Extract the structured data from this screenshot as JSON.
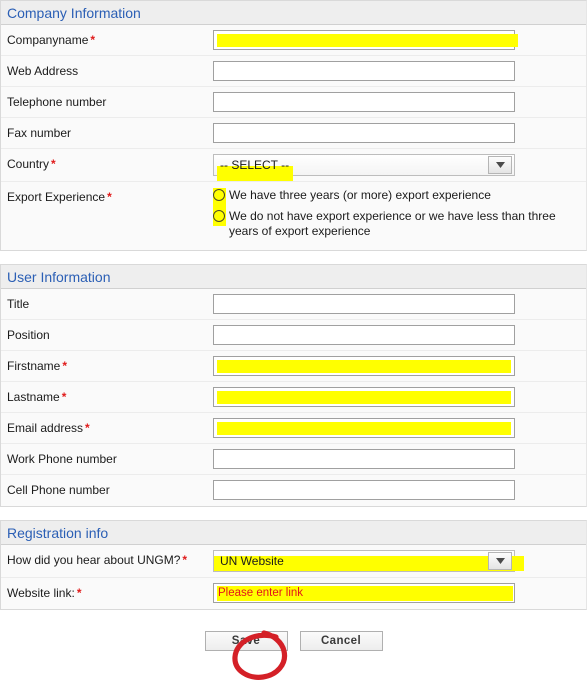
{
  "form": {
    "sections": [
      {
        "id": "company-information",
        "title": "Company Information",
        "rows": [
          {
            "label": "Companyname",
            "required": true,
            "control": "text",
            "value": "",
            "highlight": "yellow-overhang"
          },
          {
            "label": "Web Address",
            "required": false,
            "control": "text",
            "value": "",
            "highlight": "none"
          },
          {
            "label": "Telephone number",
            "required": false,
            "control": "text",
            "value": "",
            "highlight": "none"
          },
          {
            "label": "Fax number",
            "required": false,
            "control": "text",
            "value": "",
            "highlight": "none"
          },
          {
            "label": "Country",
            "required": true,
            "control": "select",
            "value": "-- SELECT --",
            "highlight": "yellow-text"
          },
          {
            "label": "Export Experience",
            "required": true,
            "control": "radio-group",
            "highlight": "yellow-strip",
            "options": [
              "We have three years (or more) export experience",
              "We do not have export experience or we have less than three years of export experience"
            ],
            "selected": -1
          }
        ]
      },
      {
        "id": "user-information",
        "title": "User Information",
        "rows": [
          {
            "label": "Title",
            "required": false,
            "control": "text",
            "value": "",
            "highlight": "none"
          },
          {
            "label": "Position",
            "required": false,
            "control": "text",
            "value": "",
            "highlight": "none"
          },
          {
            "label": "Firstname",
            "required": true,
            "control": "text",
            "value": "",
            "highlight": "yellow"
          },
          {
            "label": "Lastname",
            "required": true,
            "control": "text",
            "value": "",
            "highlight": "yellow"
          },
          {
            "label": "Email address",
            "required": true,
            "control": "text",
            "value": "",
            "highlight": "yellow"
          },
          {
            "label": "Work Phone number",
            "required": false,
            "control": "text",
            "value": "",
            "highlight": "none"
          },
          {
            "label": "Cell Phone number",
            "required": false,
            "control": "text",
            "value": "",
            "highlight": "none"
          }
        ]
      },
      {
        "id": "registration-info",
        "title": "Registration info",
        "rows": [
          {
            "label": "How did you hear about UNGM?",
            "required": true,
            "control": "select",
            "value": "UN Website",
            "highlight": "yellow-band"
          },
          {
            "label": "Website link:",
            "required": true,
            "control": "text",
            "value": "",
            "placeholder": "Please enter link",
            "highlight": "yellow-placeholder"
          }
        ]
      }
    ]
  },
  "footer": {
    "save_label": "Save",
    "cancel_label": "Cancel"
  },
  "annotation": {
    "type": "hand-drawn-circle",
    "target": "Save",
    "color": "#d42027"
  },
  "icons": {
    "dropdown_arrow": "chevron-down-icon",
    "required_marker": "asterisk-icon"
  },
  "colors": {
    "section_header_text": "#2b5fb5",
    "section_header_bg": "#eeeeee",
    "panel_bg": "#fafafa",
    "highlight": "#ffff00",
    "required": "#e01b1b",
    "placeholder": "#e4141b",
    "annotation": "#d42027"
  }
}
